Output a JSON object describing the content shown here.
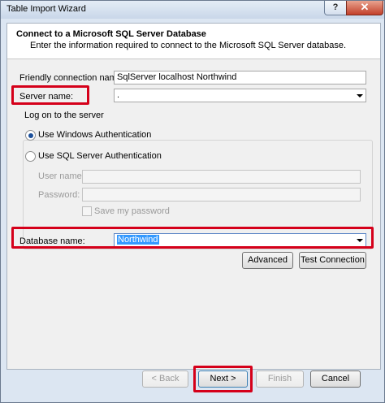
{
  "window": {
    "title": "Table Import Wizard",
    "help_glyph": "?",
    "close_glyph": "✕"
  },
  "header": {
    "title": "Connect to a Microsoft SQL Server Database",
    "subtitle": "Enter the information required to connect to the Microsoft SQL Server database."
  },
  "form": {
    "friendly_name_label": "Friendly connection name:",
    "friendly_name_value": "SqlServer localhost Northwind",
    "server_name_label": "Server name:",
    "server_name_value": ".",
    "logon_group_label": "Log on to the server",
    "windows_auth_label": "Use Windows Authentication",
    "sql_auth_label": "Use SQL Server Authentication",
    "user_name_label": "User name:",
    "password_label": "Password:",
    "save_password_label": "Save my password",
    "database_name_label": "Database name:",
    "database_name_value": "Northwind",
    "selected_auth": "windows"
  },
  "buttons": {
    "advanced": "Advanced",
    "test_connection": "Test Connection",
    "back": "< Back",
    "next": "Next >",
    "finish": "Finish",
    "cancel": "Cancel"
  },
  "colors": {
    "highlight": "#d5001a",
    "selection": "#3399ff"
  }
}
